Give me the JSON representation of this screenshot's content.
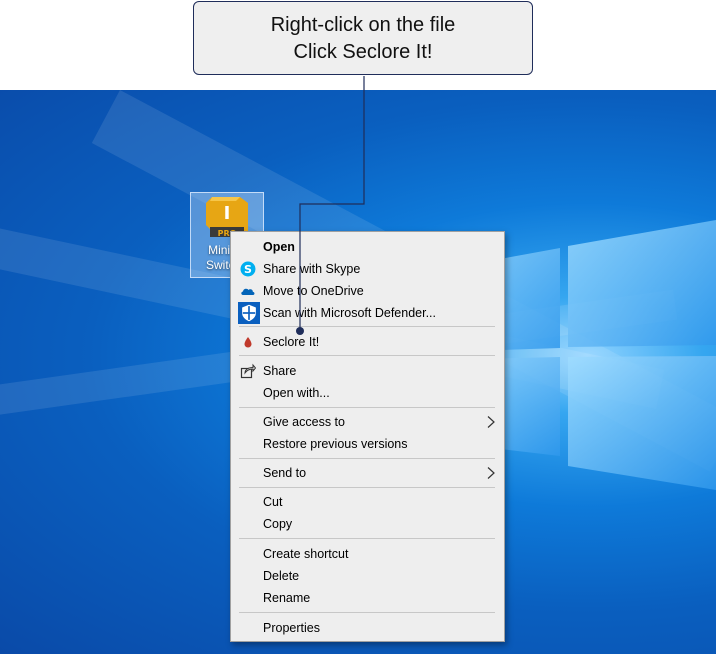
{
  "callout": {
    "line1": "Right-click on the file",
    "line2": "Click Seclore It!"
  },
  "file": {
    "label": "Mini To\nSwitche",
    "badge": "PRO",
    "glyph_letter": "I"
  },
  "menu": {
    "open": "Open",
    "share_skype": "Share with Skype",
    "onedrive": "Move to OneDrive",
    "defender": "Scan with Microsoft Defender...",
    "seclore": "Seclore It!",
    "share": "Share",
    "open_with": "Open with...",
    "give_access": "Give access to",
    "restore": "Restore previous versions",
    "send_to": "Send to",
    "cut": "Cut",
    "copy": "Copy",
    "create_shortcut": "Create shortcut",
    "delete": "Delete",
    "rename": "Rename",
    "properties": "Properties"
  },
  "icons": [
    "skype-icon",
    "onedrive-icon",
    "defender-icon",
    "seclore-icon",
    "share-icon",
    "chevron-right-icon",
    "file-icon",
    "windows-logo"
  ],
  "colors": {
    "desktop_blue": "#0a5fbf",
    "callout_border": "#1f2d5a",
    "skype": "#00aff0",
    "onedrive": "#0364b8",
    "seclore": "#c0392b"
  }
}
